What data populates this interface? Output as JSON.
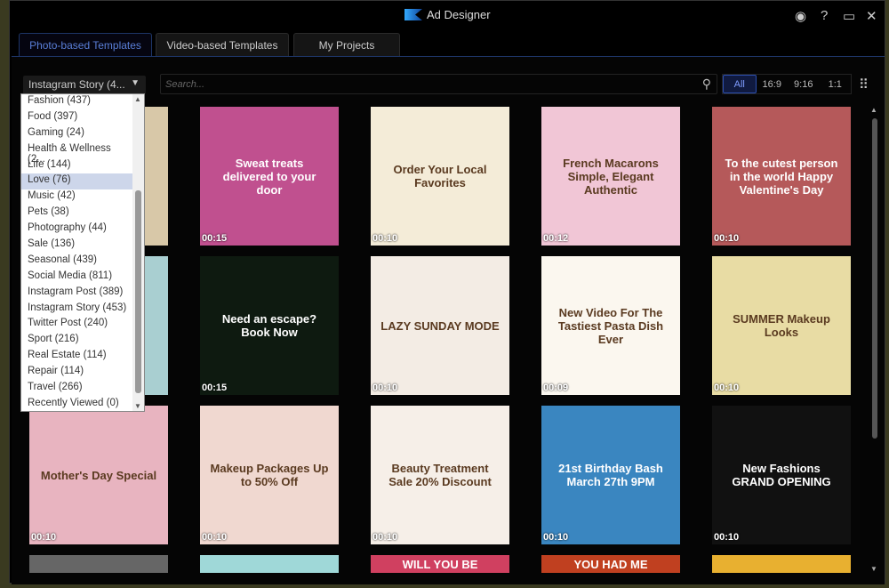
{
  "app": {
    "title": "Ad Designer",
    "icons": [
      "account-icon",
      "help-icon",
      "maximize-icon",
      "close-icon"
    ]
  },
  "tabs": [
    {
      "label": "Photo-based Templates",
      "active": true
    },
    {
      "label": "Video-based Templates"
    },
    {
      "label": "My Projects"
    }
  ],
  "category_dropdown": {
    "value": "Instagram Story (4...",
    "options": [
      "Fashion (437)",
      "Food (397)",
      "Gaming (24)",
      "Health & Wellness (2...",
      "Life (144)",
      "Love (76)",
      "Music (42)",
      "Pets (38)",
      "Photography (44)",
      "Sale (136)",
      "Seasonal (439)",
      "Social Media (811)",
      "Instagram Post (389)",
      "Instagram Story (453)",
      "Twitter Post (240)",
      "Sport (216)",
      "Real Estate (114)",
      "Repair (114)",
      "Travel (266)",
      "Recently Viewed (0)"
    ],
    "highlighted": "Love (76)"
  },
  "search": {
    "placeholder": "Search..."
  },
  "ratios": {
    "options": [
      "All",
      "16:9",
      "9:16",
      "1:1"
    ],
    "selected": "All"
  },
  "templates": [
    {
      "text": "",
      "duration": "",
      "color": "#d8c8a8"
    },
    {
      "text": "Sweat treats delivered to your door",
      "duration": "00:15",
      "color": "#c0508f"
    },
    {
      "text": "Order Your Local Favorites",
      "duration": "00:10",
      "color": "#f4ecd8"
    },
    {
      "text": "French Macarons Simple, Elegant Authentic",
      "duration": "00:12",
      "color": "#f1c6d6"
    },
    {
      "text": "To the cutest person in the world Happy Valentine's Day",
      "duration": "00:10",
      "color": "#b5595a"
    },
    {
      "text": "",
      "duration": "",
      "color": "#a9cfd1"
    },
    {
      "text": "Need an escape? Book Now",
      "duration": "00:15",
      "color": "#0e1a10"
    },
    {
      "text": "LAZY SUNDAY MODE",
      "duration": "00:10",
      "color": "#f3ece4"
    },
    {
      "text": "New Video For The Tastiest Pasta Dish Ever",
      "duration": "00:09",
      "color": "#fbf7ef"
    },
    {
      "text": "SUMMER Makeup Looks",
      "duration": "00:10",
      "color": "#e8dca4"
    },
    {
      "text": "Mother's Day Special",
      "duration": "00:10",
      "color": "#e8b4c0"
    },
    {
      "text": "Makeup Packages Up to 50% Off",
      "duration": "00:10",
      "color": "#f0d8d0"
    },
    {
      "text": "Beauty Treatment Sale 20% Discount",
      "duration": "00:10",
      "color": "#f6efe8"
    },
    {
      "text": "21st Birthday Bash March 27th 9PM",
      "duration": "00:10",
      "color": "#3a86c0"
    },
    {
      "text": "New Fashions GRAND OPENING",
      "duration": "00:10",
      "color": "#111111"
    },
    {
      "text": "",
      "duration": "",
      "color": "#666666"
    },
    {
      "text": "",
      "duration": "",
      "color": "#9fd8d8"
    },
    {
      "text": "WILL YOU BE",
      "duration": "",
      "color": "#d04060"
    },
    {
      "text": "YOU HAD ME",
      "duration": "",
      "color": "#c04020"
    },
    {
      "text": "",
      "duration": "",
      "color": "#e8b030"
    }
  ]
}
